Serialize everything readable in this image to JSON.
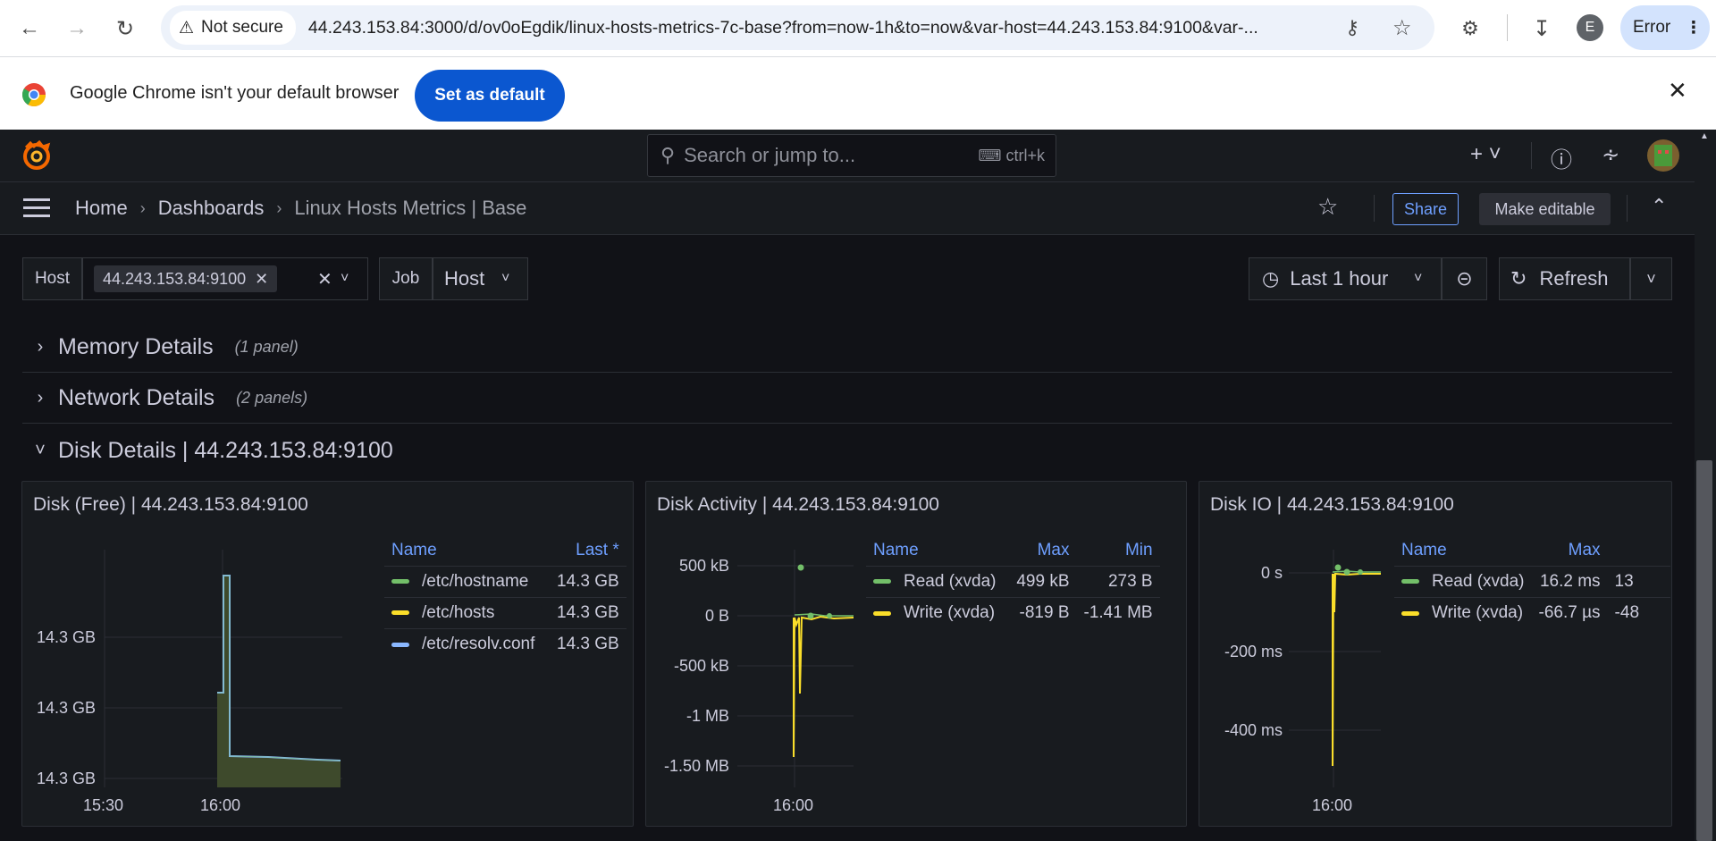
{
  "browser": {
    "not_secure": "Not secure",
    "url": "44.243.153.84:3000/d/ov0oEgdik/linux-hosts-metrics-7c-base?from=now-1h&to=now&var-host=44.243.153.84:9100&var-...",
    "profile_initial": "E",
    "error_label": "Error"
  },
  "infobar": {
    "message": "Google Chrome isn't your default browser",
    "button": "Set as default"
  },
  "grafana": {
    "search_placeholder": "Search or jump to...",
    "search_shortcut": "ctrl+k",
    "breadcrumb": {
      "home": "Home",
      "dashboards": "Dashboards",
      "current": "Linux Hosts Metrics | Base"
    },
    "share": "Share",
    "make_editable": "Make editable"
  },
  "variables": {
    "host_label": "Host",
    "host_value": "44.243.153.84:9100",
    "job_label": "Job",
    "job_value": "Host"
  },
  "time_controls": {
    "range": "Last 1 hour",
    "refresh": "Refresh"
  },
  "rows": [
    {
      "title": "Memory Details",
      "count": "(1 panel)"
    },
    {
      "title": "Network Details",
      "count": "(2 panels)"
    },
    {
      "title": "Disk Details | 44.243.153.84:9100",
      "count": ""
    }
  ],
  "panels": {
    "disk_free": {
      "title": "Disk (Free) | 44.243.153.84:9100",
      "legend_headers": [
        "Name",
        "Last *"
      ],
      "legend": [
        {
          "name": "/etc/hostname",
          "last": "14.3 GB",
          "color": "#73bf69"
        },
        {
          "name": "/etc/hosts",
          "last": "14.3 GB",
          "color": "#fade2a"
        },
        {
          "name": "/etc/resolv.conf",
          "last": "14.3 GB",
          "color": "#8ab8ff"
        }
      ]
    },
    "disk_activity": {
      "title": "Disk Activity | 44.243.153.84:9100",
      "legend_headers": [
        "Name",
        "Max",
        "Min"
      ],
      "legend": [
        {
          "name": "Read (xvda)",
          "max": "499 kB",
          "min": "273 B",
          "color": "#73bf69"
        },
        {
          "name": "Write (xvda)",
          "max": "-819 B",
          "min": "-1.41 MB",
          "color": "#fade2a"
        }
      ]
    },
    "disk_io": {
      "title": "Disk IO | 44.243.153.84:9100",
      "legend_headers": [
        "Name",
        "Max"
      ],
      "legend": [
        {
          "name": "Read (xvda)",
          "max": "16.2 ms",
          "clip": "13",
          "color": "#73bf69"
        },
        {
          "name": "Write (xvda)",
          "max": "-66.7 µs",
          "clip": "-48",
          "color": "#fade2a"
        }
      ]
    }
  },
  "chart_data": [
    {
      "type": "area",
      "title": "Disk (Free) | 44.243.153.84:9100",
      "y_tick_labels": [
        "14.3 GB",
        "14.3 GB",
        "14.3 GB"
      ],
      "x_tick_labels": [
        "15:30",
        "16:00"
      ],
      "series": [
        {
          "name": "/etc/hostname",
          "color": "#73bf69"
        },
        {
          "name": "/etc/hosts",
          "color": "#fade2a"
        },
        {
          "name": "/etc/resolv.conf",
          "color": "#8ab8ff"
        }
      ]
    },
    {
      "type": "line",
      "title": "Disk Activity | 44.243.153.84:9100",
      "y_tick_labels": [
        "500 kB",
        "0 B",
        "-500 kB",
        "-1 MB",
        "-1.50 MB"
      ],
      "x_tick_labels": [
        "16:00"
      ],
      "series": [
        {
          "name": "Read (xvda)",
          "max": 499000,
          "min": 273,
          "color": "#73bf69"
        },
        {
          "name": "Write (xvda)",
          "max": -819,
          "min": -1410000,
          "color": "#fade2a"
        }
      ]
    },
    {
      "type": "line",
      "title": "Disk IO | 44.243.153.84:9100",
      "y_tick_labels": [
        "0 s",
        "-200 ms",
        "-400 ms"
      ],
      "x_tick_labels": [
        "16:00"
      ],
      "series": [
        {
          "name": "Read (xvda)",
          "color": "#73bf69"
        },
        {
          "name": "Write (xvda)",
          "color": "#fade2a"
        }
      ]
    }
  ]
}
